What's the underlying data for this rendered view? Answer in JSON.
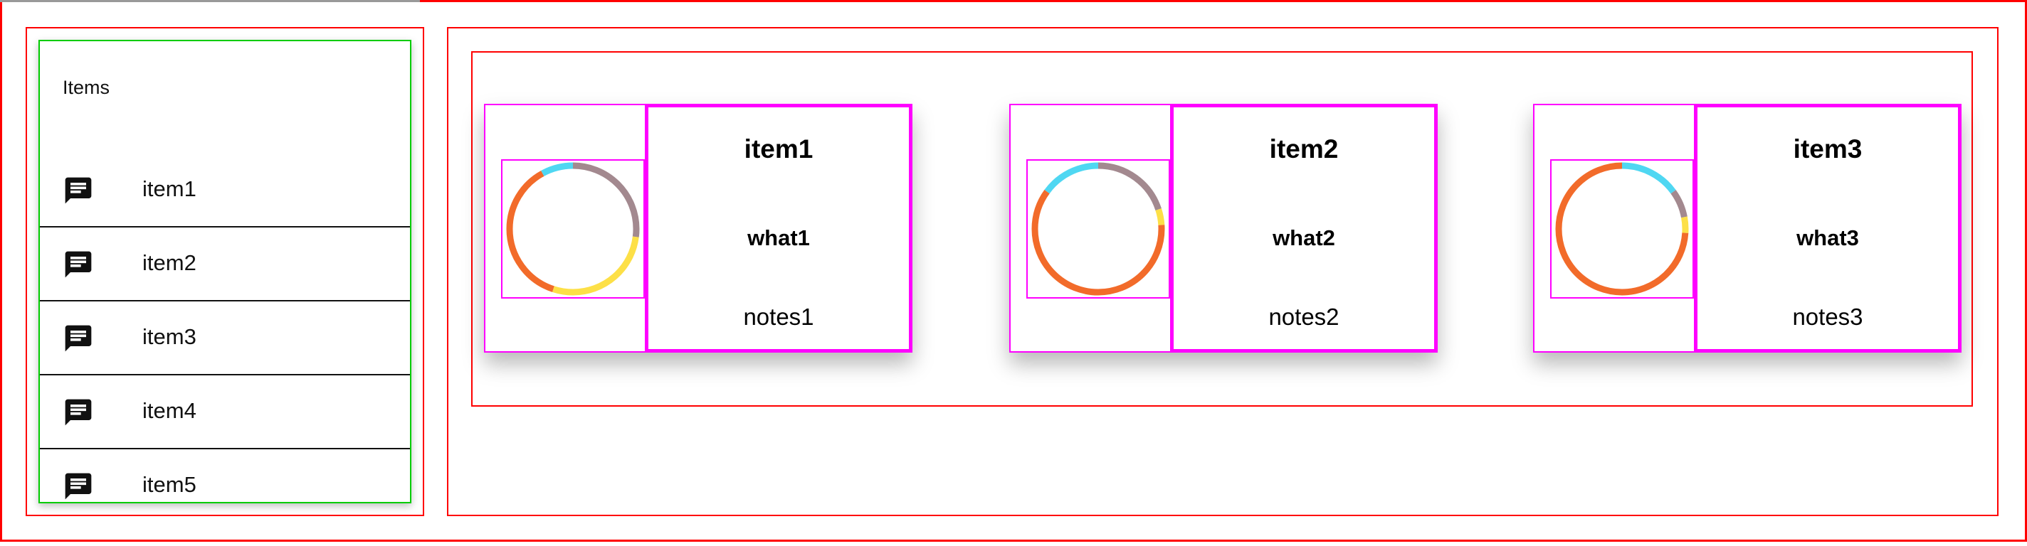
{
  "items_list": {
    "title": "Items",
    "items": [
      {
        "label": "item1",
        "icon": "chat-icon"
      },
      {
        "label": "item2",
        "icon": "chat-icon"
      },
      {
        "label": "item3",
        "icon": "chat-icon"
      },
      {
        "label": "item4",
        "icon": "chat-icon"
      },
      {
        "label": "item5",
        "icon": "chat-icon"
      }
    ]
  },
  "cards": [
    {
      "title": "item1",
      "what": "what1",
      "notes": "notes1",
      "donut": [
        {
          "color": "#a3898f",
          "fraction": 0.27
        },
        {
          "color": "#fde047",
          "fraction": 0.28
        },
        {
          "color": "#f26b2a",
          "fraction": 0.37
        },
        {
          "color": "#4fd7f2",
          "fraction": 0.08
        }
      ]
    },
    {
      "title": "item2",
      "what": "what2",
      "notes": "notes2",
      "donut": [
        {
          "color": "#a3898f",
          "fraction": 0.2
        },
        {
          "color": "#fde047",
          "fraction": 0.04
        },
        {
          "color": "#f26b2a",
          "fraction": 0.61
        },
        {
          "color": "#4fd7f2",
          "fraction": 0.15
        }
      ]
    },
    {
      "title": "item3",
      "what": "what3",
      "notes": "notes3",
      "donut": [
        {
          "color": "#4fd7f2",
          "fraction": 0.15
        },
        {
          "color": "#a3898f",
          "fraction": 0.07
        },
        {
          "color": "#fde047",
          "fraction": 0.04
        },
        {
          "color": "#f26b2a",
          "fraction": 0.74
        }
      ]
    }
  ]
}
